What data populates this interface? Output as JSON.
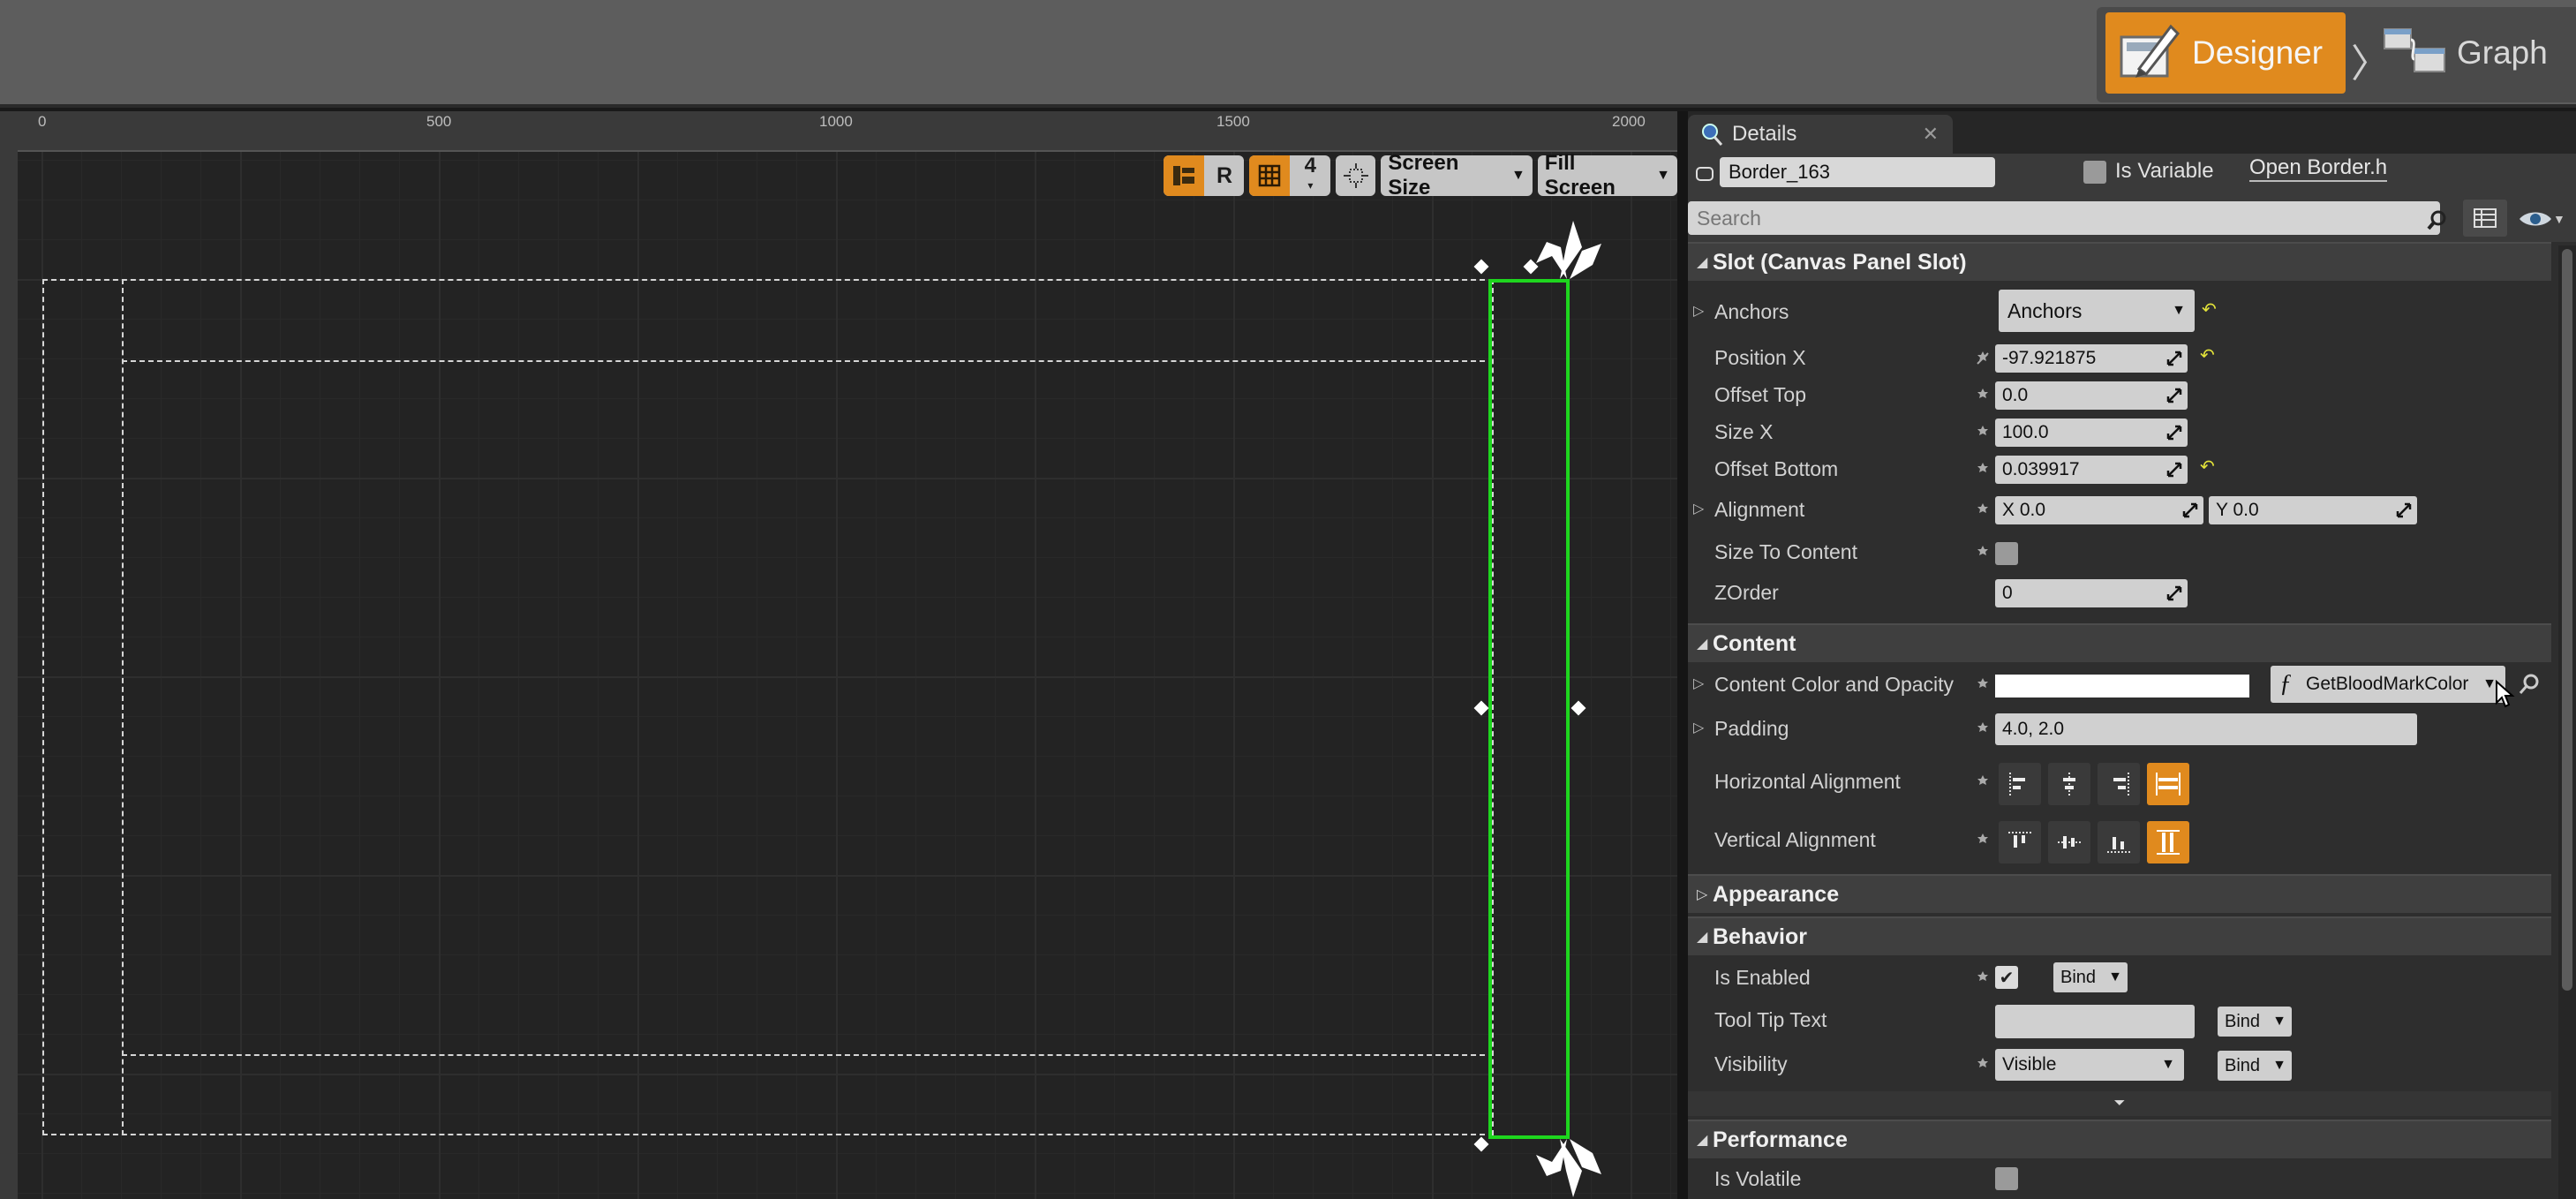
{
  "mode_switch": {
    "designer_label": "Designer",
    "graph_label": "Graph"
  },
  "ruler": {
    "ticks": [
      "0",
      "500",
      "1000",
      "1500",
      "2000"
    ]
  },
  "viewport_toolbar": {
    "r_label": "R",
    "grid_snap_value": "4",
    "screen_size_label": "Screen Size",
    "fill_screen_label": "Fill Screen"
  },
  "details": {
    "tab_title": "Details",
    "widget_name": "Border_163",
    "is_variable_label": "Is Variable",
    "open_link": "Open Border.h",
    "search_placeholder": "Search",
    "slot_category": "Slot (Canvas Panel Slot)",
    "slot": {
      "anchors_label": "Anchors",
      "anchors_value": "Anchors",
      "position_x_label": "Position X",
      "position_x_value": "-97.921875",
      "offset_top_label": "Offset Top",
      "offset_top_value": "0.0",
      "size_x_label": "Size X",
      "size_x_value": "100.0",
      "offset_bottom_label": "Offset Bottom",
      "offset_bottom_value": "0.039917",
      "alignment_label": "Alignment",
      "alignment_x": "X  0.0",
      "alignment_y": "Y  0.0",
      "size_to_content_label": "Size To Content",
      "zorder_label": "ZOrder",
      "zorder_value": "0"
    },
    "content_category": "Content",
    "content": {
      "color_label": "Content Color and Opacity",
      "color_binding": "GetBloodMarkColor",
      "padding_label": "Padding",
      "padding_value": "4.0, 2.0",
      "h_align_label": "Horizontal Alignment",
      "v_align_label": "Vertical Alignment"
    },
    "appearance_category": "Appearance",
    "behavior_category": "Behavior",
    "behavior": {
      "is_enabled_label": "Is Enabled",
      "bind_label": "Bind",
      "tooltip_label": "Tool Tip Text",
      "visibility_label": "Visibility",
      "visibility_value": "Visible"
    },
    "performance_category": "Performance",
    "performance": {
      "is_volatile_label": "Is Volatile"
    }
  },
  "colors": {
    "accent": "#e08a1e",
    "selection": "#1ed61e",
    "reset_arrow": "#e3e33a"
  }
}
